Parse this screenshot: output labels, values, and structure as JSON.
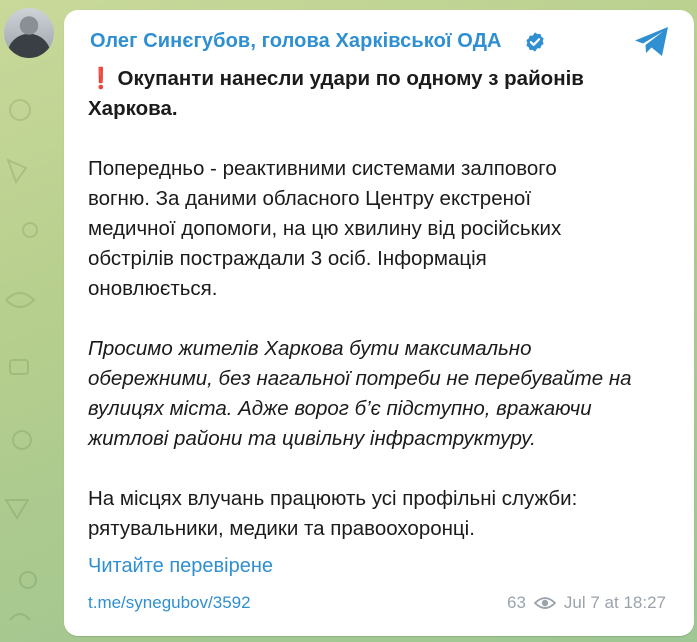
{
  "post": {
    "sender": "Олег Синєгубов, голова Харківської ОДА",
    "headline_marker": "❗",
    "headline_lines": [
      "Окупанти нанесли удари по одному з районів",
      "Харкова."
    ],
    "paragraph2_lines": [
      "Попередньо - реактивними системами залпового",
      "вогню. За даними обласного Центру екстреної",
      "медичної допомоги, на цю хвилину від російських",
      "обстрілів постраждали 3 осіб. Інформація",
      "оновлюється."
    ],
    "paragraph3_lines": [
      "Просимо жителів Харкова бути максимально",
      "обережними, без нагальної потреби не перебувайте на",
      "вулицях міста. Адже ворог б’є підступно, вражаючи",
      "житлові райони та цивільну інфраструктуру."
    ],
    "paragraph4_lines": [
      "На місцях влучань працюють усі профільні служби:",
      "рятувальники, медики та правоохоронці."
    ],
    "read_more_link": "Читайте перевірене",
    "footer_link": "t.me/synegubov/3592",
    "views": "63",
    "timestamp": "Jul 7 at 18:27"
  },
  "icons": {
    "verified": "verified-badge-icon",
    "share": "telegram-share-icon",
    "views": "eye-icon"
  },
  "colors": {
    "accent": "#2f8fd1",
    "meta": "#9aa3ab",
    "alert": "#e02424",
    "bubble": "#ffffff",
    "background": "#b7cf8e"
  }
}
